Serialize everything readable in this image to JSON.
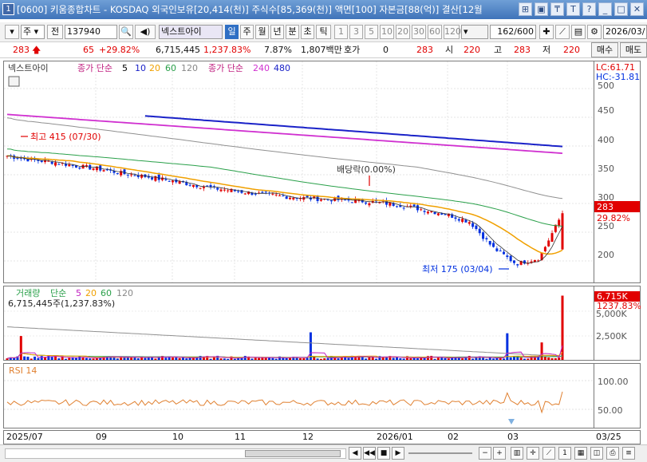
{
  "window": {
    "badge": "1",
    "title": "[0600] 키움종합차트 - KOSDAQ 외국인보유[20,414(천)] 주식수[85,369(천)] 액면[100] 자본금[88(억)] 결산[12월"
  },
  "toolbar": {
    "market": "주",
    "all_label": "전",
    "code": "137940",
    "stock_name": "넥스트아이",
    "periods": [
      "일",
      "주",
      "월",
      "년",
      "분",
      "초",
      "틱"
    ],
    "selected_period": "일",
    "intervals": [
      "1",
      "3",
      "5",
      "10",
      "20",
      "30",
      "60",
      "120"
    ],
    "count": "162",
    "count_total": "/600",
    "date": "2026/03/"
  },
  "ticker": {
    "price": "283",
    "change": "65",
    "change_pct": "+29.82%",
    "volume": "6,715,445",
    "volume_pct": "1,237.83%",
    "turnover": "7.87%",
    "amount": "1,807백만",
    "quote_label": "호가",
    "quote_value": "0",
    "quote_price": "283",
    "open_label": "시",
    "open": "220",
    "high_label": "고",
    "high": "283",
    "low_label": "저",
    "low": "220",
    "buy_label": "매수",
    "sell_label": "매도"
  },
  "price_pane": {
    "legend_name": "넥스트아이",
    "legend_ma_label": "종가 단순",
    "legend_ma_periods": [
      "5",
      "10",
      "20",
      "60",
      "120"
    ],
    "legend_ma2_label": "종가 단순",
    "legend_ma2_periods": [
      "240",
      "480"
    ],
    "lc_label": "LC:61.71",
    "hc_label": "HC:-31.81",
    "yticks": [
      "500",
      "450",
      "400",
      "350",
      "300",
      "250",
      "200"
    ],
    "high_note": "최고 415 (07/30)",
    "low_note": "최저 175 (03/04)",
    "dividend_note": "배당락(0.00%)",
    "last_price_tag": "283",
    "last_pct_tag": "29.82%"
  },
  "volume_pane": {
    "legend_label": "거래량",
    "legend_ma_label": "단순",
    "legend_ma_periods": [
      "5",
      "20",
      "60",
      "120"
    ],
    "current_value": "6,715,445주(1,237.83%)",
    "tag_value": "6,715K",
    "tag_pct": "1237.83%",
    "yticks": [
      "5,000K",
      "2,500K"
    ]
  },
  "rsi_pane": {
    "legend_label": "RSI 14",
    "yticks": [
      "100.00",
      "50.00"
    ]
  },
  "x_axis": {
    "labels": [
      "2025/07",
      "09",
      "10",
      "11",
      "12",
      "2026/01",
      "02",
      "03",
      "03/25"
    ]
  },
  "colors": {
    "up": "#e10000",
    "down": "#0030e0",
    "ma5": "#000000",
    "ma20": "#f0a000",
    "ma60": "#2aa04a",
    "ma120": "#909090",
    "ma240": "#d030d0",
    "ma480": "#1a22c8",
    "rsi": "#e08030"
  },
  "chart_data": {
    "type": "line",
    "x_range": [
      "2025/07",
      "03/25"
    ],
    "series": [
      {
        "name": "넥스트아이",
        "values": [
          383,
          376,
          372,
          365,
          360,
          352,
          347,
          340,
          333,
          326,
          321,
          316,
          312,
          309,
          307,
          305,
          302,
          297,
          289,
          281,
          268,
          223,
          195,
          205,
          283
        ]
      }
    ],
    "ylim": [
      175,
      510
    ]
  }
}
